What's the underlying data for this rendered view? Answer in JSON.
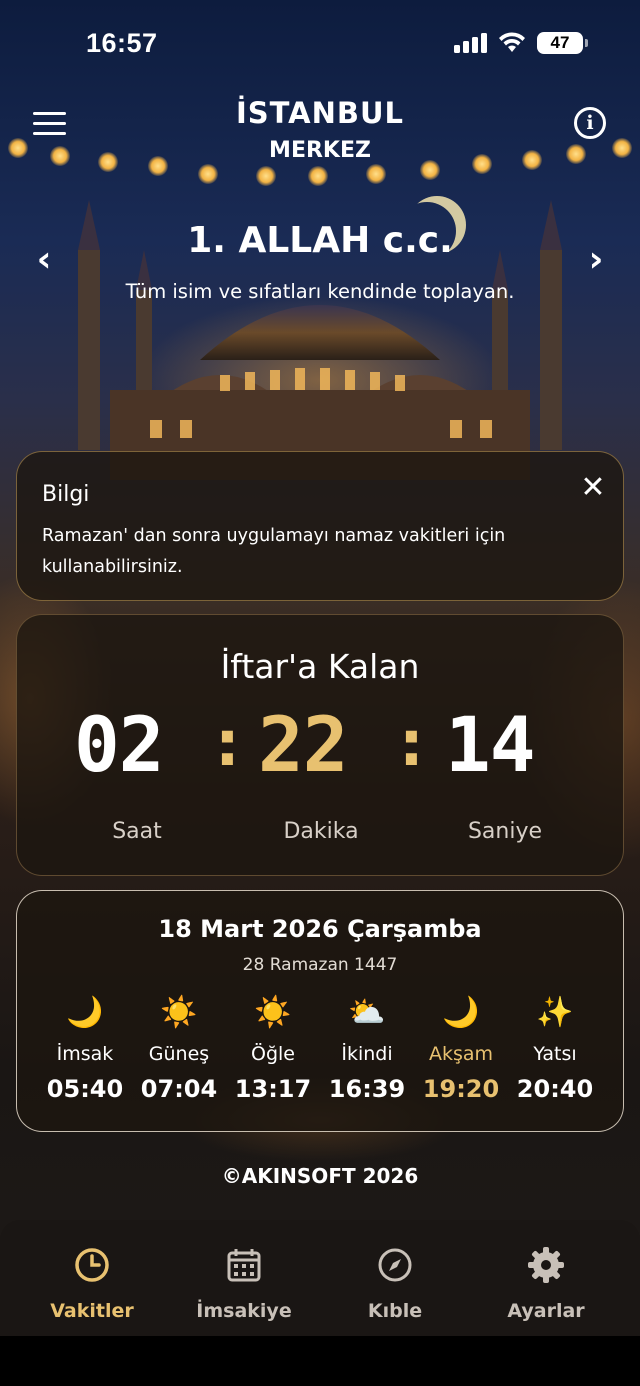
{
  "status_bar": {
    "time": "16:57",
    "battery": "47"
  },
  "header": {
    "city": "İSTANBUL",
    "district": "MERKEZ"
  },
  "name_of_allah": {
    "title": "1. ALLAH c.c.",
    "description": "Tüm isim ve sıfatları kendinde toplayan."
  },
  "info_card": {
    "title": "Bilgi",
    "body": "Ramazan' dan sonra uygulamayı namaz vakitleri için kullanabilirsiniz."
  },
  "countdown": {
    "title": "İftar'a Kalan",
    "hours": "02",
    "minutes": "22",
    "seconds": "14",
    "hours_label": "Saat",
    "minutes_label": "Dakika",
    "seconds_label": "Saniye"
  },
  "prayer_card": {
    "date": "18 Mart 2026 Çarşamba",
    "hijri": "28 Ramazan 1447",
    "times": [
      {
        "name": "İmsak",
        "time": "05:40",
        "icon": "crescent-moon-icon",
        "glyph": "🌙"
      },
      {
        "name": "Güneş",
        "time": "07:04",
        "icon": "sun-icon",
        "glyph": "☀️"
      },
      {
        "name": "Öğle",
        "time": "13:17",
        "icon": "sun-icon",
        "glyph": "☀️"
      },
      {
        "name": "İkindi",
        "time": "16:39",
        "icon": "sun-behind-cloud-icon",
        "glyph": "⛅"
      },
      {
        "name": "Akşam",
        "time": "19:20",
        "icon": "crescent-moon-icon",
        "glyph": "🌙"
      },
      {
        "name": "Yatsı",
        "time": "20:40",
        "icon": "sparkles-icon",
        "glyph": "✨"
      }
    ]
  },
  "footer": {
    "copyright": "©AKINSOFT 2026"
  },
  "tab_bar": {
    "tabs": [
      {
        "label": "Vakitler",
        "icon": "clock-icon"
      },
      {
        "label": "İmsakiye",
        "icon": "calendar-icon"
      },
      {
        "label": "Kıble",
        "icon": "compass-icon"
      },
      {
        "label": "Ayarlar",
        "icon": "gear-icon"
      }
    ],
    "active": "Vakitler"
  },
  "colors": {
    "accent_gold": "#e8c170",
    "card_border": "#c8a05a",
    "background_dark": "#1a1614"
  }
}
